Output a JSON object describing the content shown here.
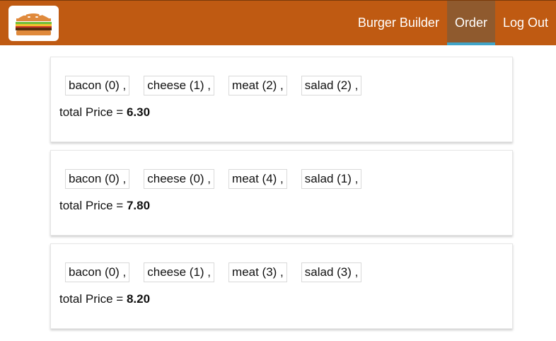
{
  "toolbar": {
    "nav": [
      {
        "label": "Burger Builder",
        "active": false
      },
      {
        "label": "Order",
        "active": true
      },
      {
        "label": "Log Out",
        "active": false
      }
    ]
  },
  "orders": [
    {
      "ingredients": [
        "bacon (0) ,",
        "cheese (1) ,",
        "meat (2) ,",
        "salad (2) ,"
      ],
      "price_label": "total Price = ",
      "price_value": "6.30"
    },
    {
      "ingredients": [
        "bacon (0) ,",
        "cheese (0) ,",
        "meat (4) ,",
        "salad (1) ,"
      ],
      "price_label": "total Price = ",
      "price_value": "7.80"
    },
    {
      "ingredients": [
        "bacon (0) ,",
        "cheese (1) ,",
        "meat (3) ,",
        "salad (3) ,"
      ],
      "price_label": "total Price = ",
      "price_value": "8.20"
    }
  ],
  "colors": {
    "toolbar_bg": "#bf5a12",
    "active_nav_bg": "#8f5a2e",
    "active_nav_underline": "#40a4c8"
  },
  "icons": {
    "logo": "burger-logo-icon"
  }
}
